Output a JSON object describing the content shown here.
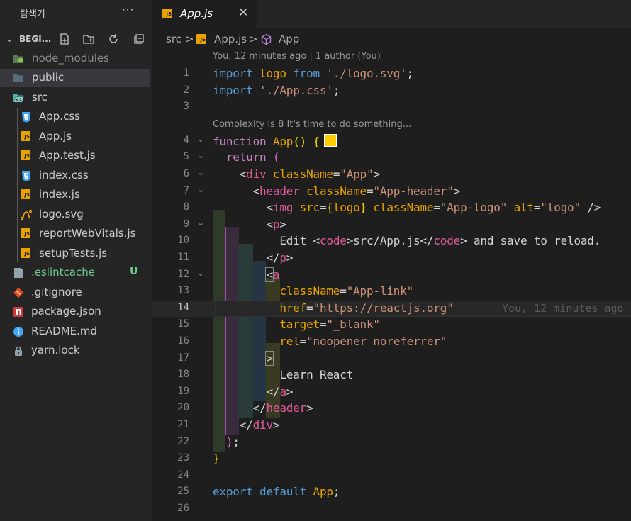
{
  "sidebar": {
    "title": "탐색기",
    "more": "···",
    "root_name": "BEGI...",
    "items": [
      {
        "name": "node_modules",
        "icon": "node-folder-icon",
        "state": "dim"
      },
      {
        "name": "public",
        "icon": "folder-icon",
        "state": "selected"
      },
      {
        "name": "src",
        "icon": "src-folder-open-icon",
        "state": "normal"
      },
      {
        "name": "App.css",
        "icon": "css-file-icon",
        "state": "normal"
      },
      {
        "name": "App.js",
        "icon": "js-file-icon",
        "state": "normal"
      },
      {
        "name": "App.test.js",
        "icon": "js-file-icon",
        "state": "normal"
      },
      {
        "name": "index.css",
        "icon": "css-file-icon",
        "state": "normal"
      },
      {
        "name": "index.js",
        "icon": "js-file-icon",
        "state": "normal"
      },
      {
        "name": "logo.svg",
        "icon": "svg-file-icon",
        "state": "normal"
      },
      {
        "name": "reportWebVitals.js",
        "icon": "js-file-icon",
        "state": "normal"
      },
      {
        "name": "setupTests.js",
        "icon": "js-file-icon",
        "state": "normal"
      },
      {
        "name": ".eslintcache",
        "icon": "file-icon",
        "state": "untracked",
        "status": "U"
      },
      {
        "name": ".gitignore",
        "icon": "git-icon",
        "state": "normal"
      },
      {
        "name": "package.json",
        "icon": "npm-icon",
        "state": "normal"
      },
      {
        "name": "README.md",
        "icon": "info-icon",
        "state": "normal"
      },
      {
        "name": "yarn.lock",
        "icon": "yarn-icon",
        "state": "normal"
      }
    ]
  },
  "tab": {
    "label": "App.js",
    "close": "✕",
    "icon_text": "JS"
  },
  "breadcrumb": {
    "folder": "src",
    "sep1": ">",
    "file": "App.js",
    "sep2": ">",
    "symbol": "App"
  },
  "codelens": {
    "author": "You, 12 minutes ago | 1 author (You)",
    "complexity": "Complexity is 8 It's time to do something..."
  },
  "blame": "You, 12 minutes ago",
  "current_line": 14,
  "swatch_color": "#ffcc00",
  "lines": [
    {
      "n": "1",
      "tokens": [
        [
          "import",
          "k"
        ],
        [
          " ",
          ""
        ],
        [
          "logo",
          "a"
        ],
        [
          " ",
          ""
        ],
        [
          "from",
          "k"
        ],
        [
          " ",
          ""
        ],
        [
          "'./logo.svg'",
          "s"
        ],
        [
          ";",
          "tx"
        ]
      ]
    },
    {
      "n": "2",
      "tokens": [
        [
          "import",
          "k"
        ],
        [
          " ",
          ""
        ],
        [
          "'./App.css'",
          "s"
        ],
        [
          ";",
          "tx"
        ]
      ]
    },
    {
      "n": "3",
      "tokens": []
    },
    {
      "n": "4",
      "fold": true,
      "tokens": [
        [
          "function",
          "p"
        ],
        [
          " ",
          ""
        ],
        [
          "App",
          "a"
        ],
        [
          "()",
          "y"
        ],
        [
          " ",
          ""
        ],
        [
          "{",
          "y"
        ]
      ],
      "swatch": true
    },
    {
      "n": "5",
      "fold": true,
      "tokens": [
        [
          "  ",
          ""
        ],
        [
          "return",
          "p"
        ],
        [
          " ",
          ""
        ],
        [
          "(",
          "b2"
        ]
      ]
    },
    {
      "n": "6",
      "fold": true,
      "tokens": [
        [
          "    ",
          ""
        ],
        [
          "<",
          "tx"
        ],
        [
          "div",
          "t"
        ],
        [
          " ",
          ""
        ],
        [
          "className",
          "a"
        ],
        [
          "=",
          "tx"
        ],
        [
          "\"App\"",
          "s"
        ],
        [
          ">",
          "tx"
        ]
      ]
    },
    {
      "n": "7",
      "fold": true,
      "tokens": [
        [
          "      ",
          ""
        ],
        [
          "<",
          "tx"
        ],
        [
          "header",
          "t"
        ],
        [
          " ",
          ""
        ],
        [
          "className",
          "a"
        ],
        [
          "=",
          "tx"
        ],
        [
          "\"App-header\"",
          "s"
        ],
        [
          ">",
          "tx"
        ]
      ]
    },
    {
      "n": "8",
      "tokens": [
        [
          "        ",
          ""
        ],
        [
          "<",
          "tx"
        ],
        [
          "img",
          "t"
        ],
        [
          " ",
          ""
        ],
        [
          "src",
          "a"
        ],
        [
          "=",
          "tx"
        ],
        [
          "{",
          "y"
        ],
        [
          "logo",
          "a"
        ],
        [
          "}",
          "y"
        ],
        [
          " ",
          ""
        ],
        [
          "className",
          "a"
        ],
        [
          "=",
          "tx"
        ],
        [
          "\"App-logo\"",
          "s"
        ],
        [
          " ",
          ""
        ],
        [
          "alt",
          "a"
        ],
        [
          "=",
          "tx"
        ],
        [
          "\"logo\"",
          "s"
        ],
        [
          " />",
          "tx"
        ]
      ]
    },
    {
      "n": "9",
      "fold": true,
      "tokens": [
        [
          "        ",
          ""
        ],
        [
          "<",
          "tx"
        ],
        [
          "p",
          "t"
        ],
        [
          ">",
          "tx"
        ]
      ]
    },
    {
      "n": "10",
      "tokens": [
        [
          "          ",
          ""
        ],
        [
          "Edit ",
          "tx"
        ],
        [
          "<",
          "tx"
        ],
        [
          "code",
          "t"
        ],
        [
          ">",
          "tx"
        ],
        [
          "src/App.js",
          "tx"
        ],
        [
          "</",
          "tx"
        ],
        [
          "code",
          "t"
        ],
        [
          ">",
          "tx"
        ],
        [
          " and save to reload.",
          "tx"
        ]
      ]
    },
    {
      "n": "11",
      "tokens": [
        [
          "        ",
          ""
        ],
        [
          "</",
          "tx"
        ],
        [
          "p",
          "t"
        ],
        [
          ">",
          "tx"
        ]
      ]
    },
    {
      "n": "12",
      "fold": true,
      "tokens": [
        [
          "        ",
          ""
        ],
        [
          "<",
          "boxed"
        ],
        [
          "a",
          "t"
        ]
      ]
    },
    {
      "n": "13",
      "tokens": [
        [
          "          ",
          ""
        ],
        [
          "className",
          "a"
        ],
        [
          "=",
          "tx"
        ],
        [
          "\"App-link\"",
          "s"
        ]
      ]
    },
    {
      "n": "14",
      "tokens": [
        [
          "          ",
          ""
        ],
        [
          "href",
          "a"
        ],
        [
          "=",
          "tx"
        ],
        [
          "\"",
          "s"
        ],
        [
          "https://reactjs.org",
          "s u"
        ],
        [
          "\"",
          "s"
        ]
      ],
      "blame": true
    },
    {
      "n": "15",
      "tokens": [
        [
          "          ",
          ""
        ],
        [
          "target",
          "a"
        ],
        [
          "=",
          "tx"
        ],
        [
          "\"_blank\"",
          "s"
        ]
      ]
    },
    {
      "n": "16",
      "tokens": [
        [
          "          ",
          ""
        ],
        [
          "rel",
          "a"
        ],
        [
          "=",
          "tx"
        ],
        [
          "\"noopener noreferrer\"",
          "s"
        ]
      ]
    },
    {
      "n": "17",
      "tokens": [
        [
          "        ",
          ""
        ],
        [
          ">",
          "boxed"
        ]
      ]
    },
    {
      "n": "18",
      "tokens": [
        [
          "          ",
          ""
        ],
        [
          "Learn React",
          "tx"
        ]
      ]
    },
    {
      "n": "19",
      "tokens": [
        [
          "        ",
          ""
        ],
        [
          "</",
          "tx"
        ],
        [
          "a",
          "t"
        ],
        [
          ">",
          "tx"
        ]
      ]
    },
    {
      "n": "20",
      "tokens": [
        [
          "      ",
          ""
        ],
        [
          "</",
          "tx"
        ],
        [
          "header",
          "t"
        ],
        [
          ">",
          "tx"
        ]
      ]
    },
    {
      "n": "21",
      "tokens": [
        [
          "    ",
          ""
        ],
        [
          "</",
          "tx"
        ],
        [
          "div",
          "t"
        ],
        [
          ">",
          "tx"
        ]
      ]
    },
    {
      "n": "22",
      "tokens": [
        [
          "  ",
          ""
        ],
        [
          ")",
          "b2"
        ],
        [
          ";",
          "tx"
        ]
      ]
    },
    {
      "n": "23",
      "tokens": [
        [
          "}",
          "y"
        ]
      ]
    },
    {
      "n": "24",
      "tokens": []
    },
    {
      "n": "25",
      "tokens": [
        [
          "export",
          "k"
        ],
        [
          " ",
          ""
        ],
        [
          "default",
          "k"
        ],
        [
          " ",
          ""
        ],
        [
          "App",
          "a"
        ],
        [
          ";",
          "tx"
        ]
      ]
    },
    {
      "n": "26",
      "tokens": []
    }
  ]
}
